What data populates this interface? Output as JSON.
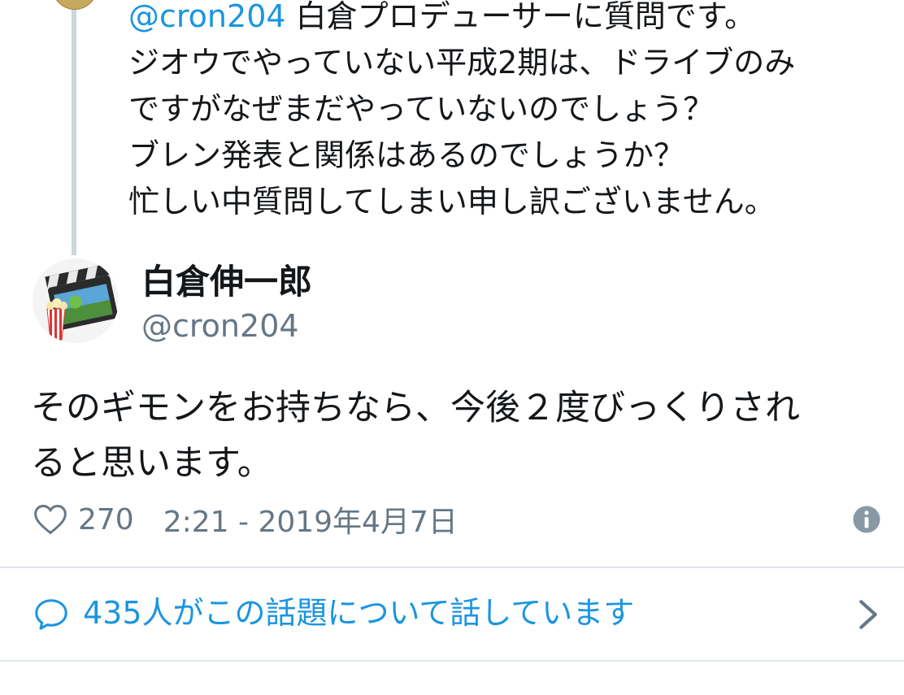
{
  "parent_tweet": {
    "mention": "@cron204",
    "lines": [
      " 白倉プロデューサーに質問です。",
      "ジオウでやっていない平成2期は、ドライブのみ",
      "ですがなぜまだやっていないのでしょう？",
      "ブレン発表と関係はあるのでしょうか？",
      "忙しい中質問してしまい申し訳ございません。"
    ]
  },
  "tweet": {
    "display_name": "白倉伸一郎",
    "handle": "@cron204",
    "text_lines": [
      "そのギモンをお持ちなら、今後２度びっくりされ",
      "ると思います。"
    ],
    "like_count": "270",
    "timestamp": "2:21 - 2019年4月7日"
  },
  "conversation": {
    "label": "435人がこの話題について話しています"
  },
  "icons": {
    "like": "heart-icon",
    "info": "info-icon",
    "reply": "speech-bubble-icon",
    "more": "chevron-right-icon"
  },
  "colors": {
    "link": "#1b95e0",
    "text": "#14171a",
    "muted": "#657786",
    "divider": "#e1e8ed",
    "thread_line": "#ccd6dd"
  }
}
